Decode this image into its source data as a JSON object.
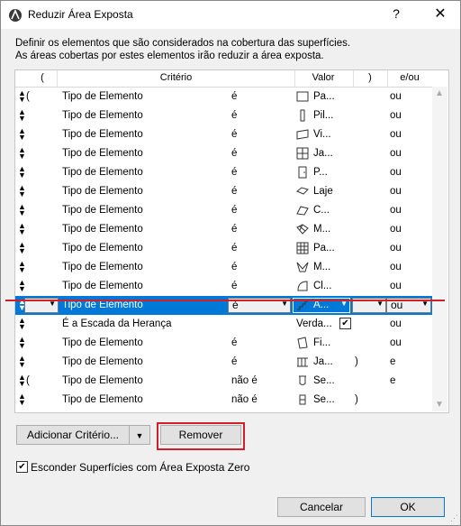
{
  "window": {
    "title": "Reduzir Área Exposta",
    "help": "?",
    "close": "✕"
  },
  "description": {
    "line1": "Definir os elementos que são considerados na cobertura das superfícies.",
    "line2": "As áreas cobertas por estes elementos irão reduzir a área exposta."
  },
  "table": {
    "headers": {
      "open": "(",
      "criterion": "Critério",
      "value": "Valor",
      "close": ")",
      "op": "e/ou"
    },
    "rows": [
      {
        "open": "(",
        "criterion": "Tipo de Elemento",
        "cond": "é",
        "icon": "wall-icon",
        "value": "Pa...",
        "close": "",
        "op": "ou"
      },
      {
        "open": "",
        "criterion": "Tipo de Elemento",
        "cond": "é",
        "icon": "column-icon",
        "value": "Pil...",
        "close": "",
        "op": "ou"
      },
      {
        "open": "",
        "criterion": "Tipo de Elemento",
        "cond": "é",
        "icon": "beam-icon",
        "value": "Vi...",
        "close": "",
        "op": "ou"
      },
      {
        "open": "",
        "criterion": "Tipo de Elemento",
        "cond": "é",
        "icon": "window-icon",
        "value": "Ja...",
        "close": "",
        "op": "ou"
      },
      {
        "open": "",
        "criterion": "Tipo de Elemento",
        "cond": "é",
        "icon": "door-icon",
        "value": "P...",
        "close": "",
        "op": "ou"
      },
      {
        "open": "",
        "criterion": "Tipo de Elemento",
        "cond": "é",
        "icon": "slab-icon",
        "value": "Laje",
        "close": "",
        "op": "ou"
      },
      {
        "open": "",
        "criterion": "Tipo de Elemento",
        "cond": "é",
        "icon": "roof-icon",
        "value": "C...",
        "close": "",
        "op": "ou"
      },
      {
        "open": "",
        "criterion": "Tipo de Elemento",
        "cond": "é",
        "icon": "mesh-icon",
        "value": "M...",
        "close": "",
        "op": "ou"
      },
      {
        "open": "",
        "criterion": "Tipo de Elemento",
        "cond": "é",
        "icon": "curtain-wall-icon",
        "value": "Pa...",
        "close": "",
        "op": "ou"
      },
      {
        "open": "",
        "criterion": "Tipo de Elemento",
        "cond": "é",
        "icon": "morph-icon",
        "value": "M...",
        "close": "",
        "op": "ou"
      },
      {
        "open": "",
        "criterion": "Tipo de Elemento",
        "cond": "é",
        "icon": "shell-icon",
        "value": "Cl...",
        "close": "",
        "op": "ou"
      },
      {
        "open": "",
        "criterion": "Tipo de Elemento",
        "cond": "é",
        "icon": "stair-icon",
        "value": "A...",
        "close": "",
        "op": "ou",
        "selected": true
      },
      {
        "open": "",
        "criterion": "É a Escada da Herança",
        "cond": "",
        "icon": "",
        "value": "Verda...",
        "close": "",
        "op": "ou",
        "checkbox": true
      },
      {
        "open": "",
        "criterion": "Tipo de Elemento",
        "cond": "é",
        "icon": "skylight-icon",
        "value": "Fi...",
        "close": "",
        "op": "ou"
      },
      {
        "open": "",
        "criterion": "Tipo de Elemento",
        "cond": "é",
        "icon": "railing-icon",
        "value": "Ja...",
        "close": ")",
        "op": "e"
      },
      {
        "open": "(",
        "criterion": "Tipo de Elemento",
        "cond": "não é",
        "icon": "object-icon",
        "value": "Se...",
        "close": "",
        "op": "e"
      },
      {
        "open": "",
        "criterion": "Tipo de Elemento",
        "cond": "não é",
        "icon": "zone-icon",
        "value": "Se...",
        "close": ")",
        "op": ""
      }
    ]
  },
  "buttons": {
    "add": "Adicionar Critério...",
    "remove": "Remover",
    "cancel": "Cancelar",
    "ok": "OK"
  },
  "checkbox": {
    "label": "Esconder Superfícies com Área Exposta Zero",
    "checked": true
  },
  "colors": {
    "selection": "#0078d7",
    "highlight": "#d0202a"
  }
}
